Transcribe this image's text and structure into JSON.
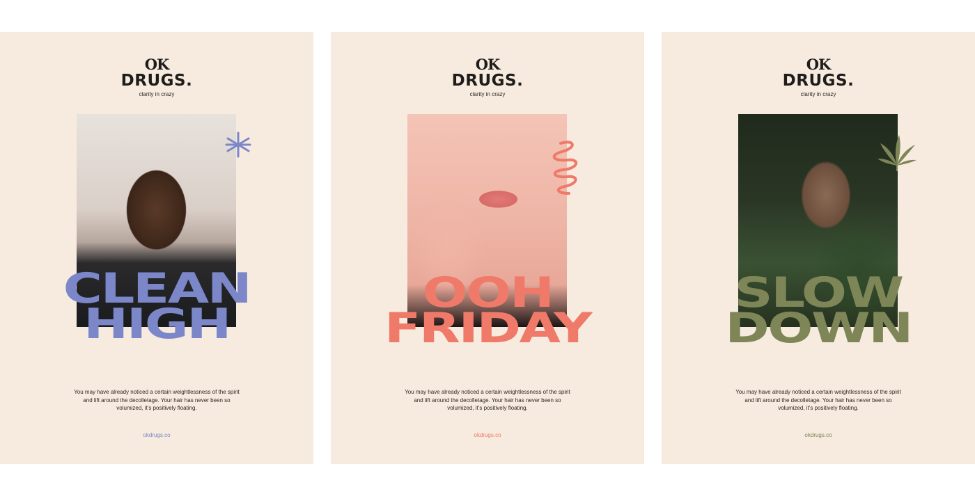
{
  "brand": {
    "logo_line1": "OK",
    "logo_line2": "DRUGS.",
    "tagline": "clarity in crazy"
  },
  "posters": [
    {
      "headline_line1": "CLEAN",
      "headline_line2": "HIGH",
      "accent_color": "#7b87c9",
      "decoration_icon": "asterisk-icon",
      "body": "You may have already noticed a certain weightlessness of the spirit and lift around the decolletage. Your hair has never been so volumized, it’s positively floating.",
      "url": "okdrugs.co"
    },
    {
      "headline_line1": "OOH",
      "headline_line2": "FRIDAY",
      "accent_color": "#ef7a6a",
      "decoration_icon": "spiral-icon",
      "body": "You may have already noticed a certain weightlessness of the spirit and lift around the decolletage. Your hair has never been so volumized, it’s positively floating.",
      "url": "okdrugs.co"
    },
    {
      "headline_line1": "SLOW",
      "headline_line2": "DOWN",
      "accent_color": "#7e8657",
      "decoration_icon": "leaf-icon",
      "body": "You may have already noticed a certain weightlessness of the spirit and lift around the decolletage. Your hair has never been so volumized, it’s positively floating.",
      "url": "okdrugs.co"
    }
  ]
}
